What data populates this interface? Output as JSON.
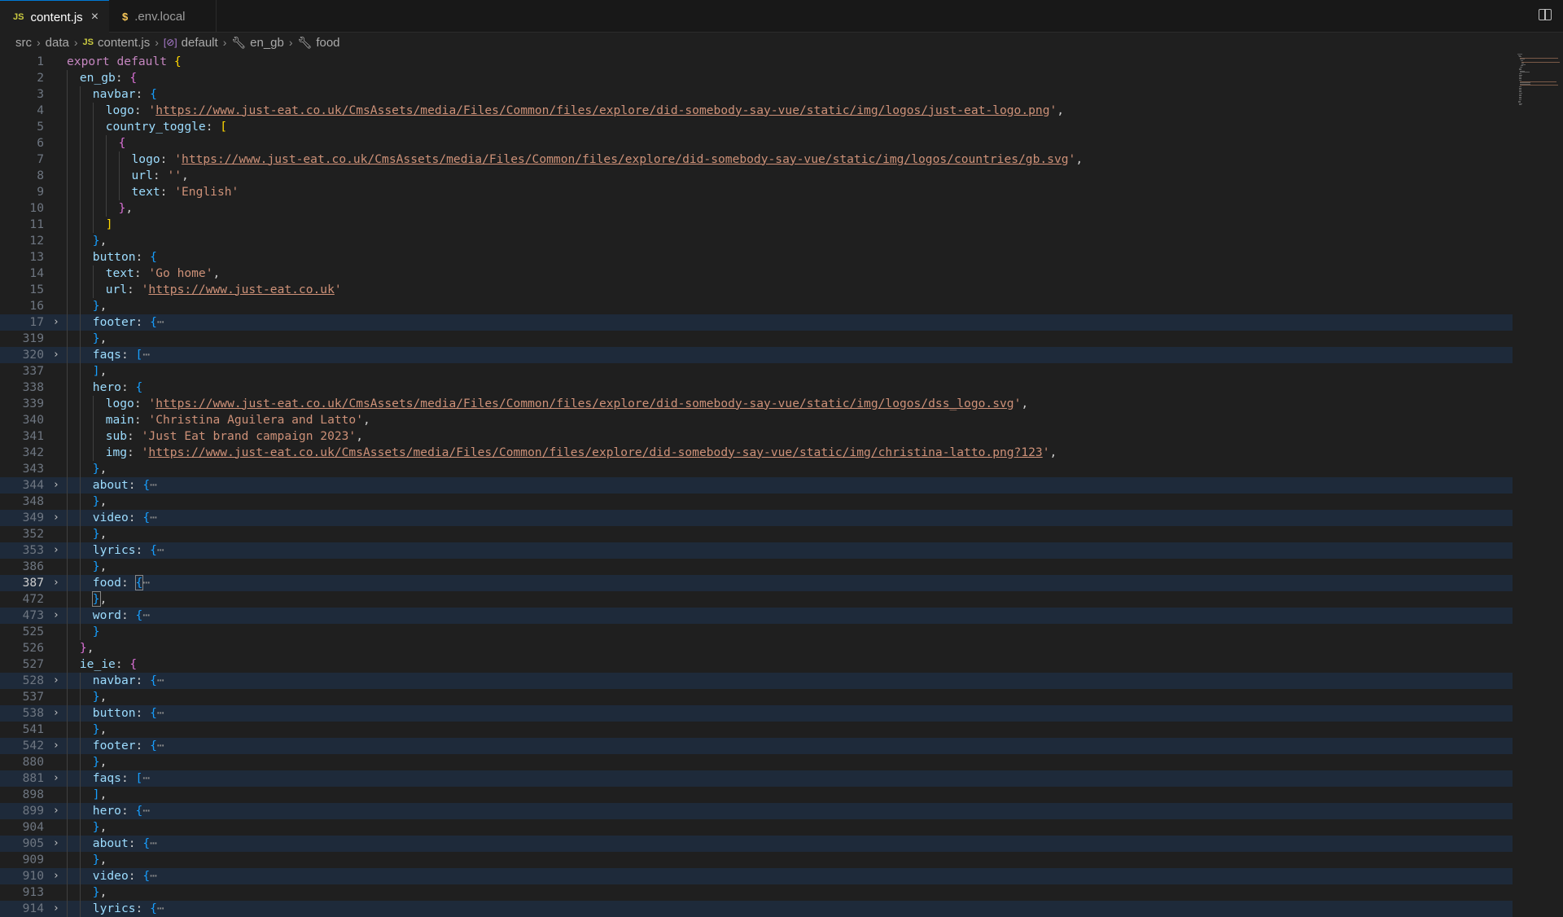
{
  "tabs": [
    {
      "label": "content.js",
      "icon": "JS",
      "close": "×"
    },
    {
      "label": ".env.local",
      "icon": "$"
    }
  ],
  "breadcrumbs": [
    {
      "label": "src",
      "icon": ""
    },
    {
      "label": "data",
      "icon": ""
    },
    {
      "label": "content.js",
      "icon": "JS"
    },
    {
      "label": "default",
      "icon": "[⊘]"
    },
    {
      "label": "en_gb",
      "icon": "wrench"
    },
    {
      "label": "food",
      "icon": "wrench"
    }
  ],
  "colors": {
    "string": "#ce9178",
    "property": "#9cdcfe",
    "keyword": "#c586c0",
    "folded_bg": "#1e2a3a"
  },
  "lines": [
    {
      "n": "1",
      "indent": 0,
      "fold": false,
      "toks": [
        [
          "kw",
          "export "
        ],
        [
          "kw",
          "default "
        ],
        [
          "p1",
          "{"
        ]
      ]
    },
    {
      "n": "2",
      "indent": 1,
      "fold": false,
      "toks": [
        [
          "prop",
          "en_gb"
        ],
        [
          "pun",
          ": "
        ],
        [
          "p2",
          "{"
        ]
      ]
    },
    {
      "n": "3",
      "indent": 2,
      "fold": false,
      "toks": [
        [
          "prop",
          "navbar"
        ],
        [
          "pun",
          ": "
        ],
        [
          "p3",
          "{"
        ]
      ]
    },
    {
      "n": "4",
      "indent": 3,
      "fold": false,
      "toks": [
        [
          "prop",
          "logo"
        ],
        [
          "pun",
          ": "
        ],
        [
          "str",
          "'"
        ],
        [
          "url",
          "https://www.just-eat.co.uk/CmsAssets/media/Files/Common/files/explore/did-somebody-say-vue/static/img/logos/just-eat-logo.png"
        ],
        [
          "str",
          "'"
        ],
        [
          "pun",
          ","
        ]
      ]
    },
    {
      "n": "5",
      "indent": 3,
      "fold": false,
      "toks": [
        [
          "prop",
          "country_toggle"
        ],
        [
          "pun",
          ": "
        ],
        [
          "p1",
          "["
        ]
      ]
    },
    {
      "n": "6",
      "indent": 4,
      "fold": false,
      "toks": [
        [
          "p2",
          "{"
        ]
      ]
    },
    {
      "n": "7",
      "indent": 5,
      "fold": false,
      "toks": [
        [
          "prop",
          "logo"
        ],
        [
          "pun",
          ": "
        ],
        [
          "str",
          "'"
        ],
        [
          "url",
          "https://www.just-eat.co.uk/CmsAssets/media/Files/Common/files/explore/did-somebody-say-vue/static/img/logos/countries/gb.svg"
        ],
        [
          "str",
          "'"
        ],
        [
          "pun",
          ","
        ]
      ]
    },
    {
      "n": "8",
      "indent": 5,
      "fold": false,
      "toks": [
        [
          "prop",
          "url"
        ],
        [
          "pun",
          ": "
        ],
        [
          "str",
          "''"
        ],
        [
          "pun",
          ","
        ]
      ]
    },
    {
      "n": "9",
      "indent": 5,
      "fold": false,
      "toks": [
        [
          "prop",
          "text"
        ],
        [
          "pun",
          ": "
        ],
        [
          "str",
          "'English'"
        ]
      ]
    },
    {
      "n": "10",
      "indent": 4,
      "fold": false,
      "toks": [
        [
          "p2",
          "}"
        ],
        [
          "pun",
          ","
        ]
      ]
    },
    {
      "n": "11",
      "indent": 3,
      "fold": false,
      "toks": [
        [
          "p1",
          "]"
        ]
      ]
    },
    {
      "n": "12",
      "indent": 2,
      "fold": false,
      "toks": [
        [
          "p3",
          "}"
        ],
        [
          "pun",
          ","
        ]
      ]
    },
    {
      "n": "13",
      "indent": 2,
      "fold": false,
      "toks": [
        [
          "prop",
          "button"
        ],
        [
          "pun",
          ": "
        ],
        [
          "p3",
          "{"
        ]
      ]
    },
    {
      "n": "14",
      "indent": 3,
      "fold": false,
      "toks": [
        [
          "prop",
          "text"
        ],
        [
          "pun",
          ": "
        ],
        [
          "str",
          "'Go home'"
        ],
        [
          "pun",
          ","
        ]
      ]
    },
    {
      "n": "15",
      "indent": 3,
      "fold": false,
      "toks": [
        [
          "prop",
          "url"
        ],
        [
          "pun",
          ": "
        ],
        [
          "str",
          "'"
        ],
        [
          "url",
          "https://www.just-eat.co.uk"
        ],
        [
          "str",
          "'"
        ]
      ]
    },
    {
      "n": "16",
      "indent": 2,
      "fold": false,
      "toks": [
        [
          "p3",
          "}"
        ],
        [
          "pun",
          ","
        ]
      ]
    },
    {
      "n": "17",
      "indent": 2,
      "fold": true,
      "toks": [
        [
          "prop",
          "footer"
        ],
        [
          "pun",
          ": "
        ],
        [
          "p3",
          "{"
        ],
        [
          "ell",
          "⋯"
        ]
      ]
    },
    {
      "n": "319",
      "indent": 2,
      "fold": false,
      "toks": [
        [
          "p3",
          "}"
        ],
        [
          "pun",
          ","
        ]
      ]
    },
    {
      "n": "320",
      "indent": 2,
      "fold": true,
      "toks": [
        [
          "prop",
          "faqs"
        ],
        [
          "pun",
          ": "
        ],
        [
          "p3",
          "["
        ],
        [
          "ell",
          "⋯"
        ]
      ]
    },
    {
      "n": "337",
      "indent": 2,
      "fold": false,
      "toks": [
        [
          "p3",
          "]"
        ],
        [
          "pun",
          ","
        ]
      ]
    },
    {
      "n": "338",
      "indent": 2,
      "fold": false,
      "toks": [
        [
          "prop",
          "hero"
        ],
        [
          "pun",
          ": "
        ],
        [
          "p3",
          "{"
        ]
      ]
    },
    {
      "n": "339",
      "indent": 3,
      "fold": false,
      "toks": [
        [
          "prop",
          "logo"
        ],
        [
          "pun",
          ": "
        ],
        [
          "str",
          "'"
        ],
        [
          "url",
          "https://www.just-eat.co.uk/CmsAssets/media/Files/Common/files/explore/did-somebody-say-vue/static/img/logos/dss_logo.svg"
        ],
        [
          "str",
          "'"
        ],
        [
          "pun",
          ","
        ]
      ]
    },
    {
      "n": "340",
      "indent": 3,
      "fold": false,
      "toks": [
        [
          "prop",
          "main"
        ],
        [
          "pun",
          ": "
        ],
        [
          "str",
          "'Christina Aguilera and Latto'"
        ],
        [
          "pun",
          ","
        ]
      ]
    },
    {
      "n": "341",
      "indent": 3,
      "fold": false,
      "toks": [
        [
          "prop",
          "sub"
        ],
        [
          "pun",
          ": "
        ],
        [
          "str",
          "'Just Eat brand campaign 2023'"
        ],
        [
          "pun",
          ","
        ]
      ]
    },
    {
      "n": "342",
      "indent": 3,
      "fold": false,
      "toks": [
        [
          "prop",
          "img"
        ],
        [
          "pun",
          ": "
        ],
        [
          "str",
          "'"
        ],
        [
          "url",
          "https://www.just-eat.co.uk/CmsAssets/media/Files/Common/files/explore/did-somebody-say-vue/static/img/christina-latto.png?123"
        ],
        [
          "str",
          "'"
        ],
        [
          "pun",
          ","
        ]
      ]
    },
    {
      "n": "343",
      "indent": 2,
      "fold": false,
      "toks": [
        [
          "p3",
          "}"
        ],
        [
          "pun",
          ","
        ]
      ]
    },
    {
      "n": "344",
      "indent": 2,
      "fold": true,
      "toks": [
        [
          "prop",
          "about"
        ],
        [
          "pun",
          ": "
        ],
        [
          "p3",
          "{"
        ],
        [
          "ell",
          "⋯"
        ]
      ]
    },
    {
      "n": "348",
      "indent": 2,
      "fold": false,
      "toks": [
        [
          "p3",
          "}"
        ],
        [
          "pun",
          ","
        ]
      ]
    },
    {
      "n": "349",
      "indent": 2,
      "fold": true,
      "toks": [
        [
          "prop",
          "video"
        ],
        [
          "pun",
          ": "
        ],
        [
          "p3",
          "{"
        ],
        [
          "ell",
          "⋯"
        ]
      ]
    },
    {
      "n": "352",
      "indent": 2,
      "fold": false,
      "toks": [
        [
          "p3",
          "}"
        ],
        [
          "pun",
          ","
        ]
      ]
    },
    {
      "n": "353",
      "indent": 2,
      "fold": true,
      "toks": [
        [
          "prop",
          "lyrics"
        ],
        [
          "pun",
          ": "
        ],
        [
          "p3",
          "{"
        ],
        [
          "ell",
          "⋯"
        ]
      ]
    },
    {
      "n": "386",
      "indent": 2,
      "fold": false,
      "toks": [
        [
          "p3",
          "}"
        ],
        [
          "pun",
          ","
        ]
      ]
    },
    {
      "n": "387",
      "indent": 2,
      "fold": true,
      "current": true,
      "toks": [
        [
          "prop",
          "food"
        ],
        [
          "pun",
          ": "
        ],
        [
          "p3 bmatch",
          "{"
        ],
        [
          "ell",
          "⋯"
        ]
      ]
    },
    {
      "n": "472",
      "indent": 2,
      "fold": false,
      "toks": [
        [
          "p3 bmatch",
          "}"
        ],
        [
          "pun",
          ","
        ]
      ]
    },
    {
      "n": "473",
      "indent": 2,
      "fold": true,
      "toks": [
        [
          "prop",
          "word"
        ],
        [
          "pun",
          ": "
        ],
        [
          "p3",
          "{"
        ],
        [
          "ell",
          "⋯"
        ]
      ]
    },
    {
      "n": "525",
      "indent": 2,
      "fold": false,
      "toks": [
        [
          "p3",
          "}"
        ]
      ]
    },
    {
      "n": "526",
      "indent": 1,
      "fold": false,
      "toks": [
        [
          "p2",
          "}"
        ],
        [
          "pun",
          ","
        ]
      ]
    },
    {
      "n": "527",
      "indent": 1,
      "fold": false,
      "toks": [
        [
          "prop",
          "ie_ie"
        ],
        [
          "pun",
          ": "
        ],
        [
          "p2",
          "{"
        ]
      ]
    },
    {
      "n": "528",
      "indent": 2,
      "fold": true,
      "toks": [
        [
          "prop",
          "navbar"
        ],
        [
          "pun",
          ": "
        ],
        [
          "p3",
          "{"
        ],
        [
          "ell",
          "⋯"
        ]
      ]
    },
    {
      "n": "537",
      "indent": 2,
      "fold": false,
      "toks": [
        [
          "p3",
          "}"
        ],
        [
          "pun",
          ","
        ]
      ]
    },
    {
      "n": "538",
      "indent": 2,
      "fold": true,
      "toks": [
        [
          "prop",
          "button"
        ],
        [
          "pun",
          ": "
        ],
        [
          "p3",
          "{"
        ],
        [
          "ell",
          "⋯"
        ]
      ]
    },
    {
      "n": "541",
      "indent": 2,
      "fold": false,
      "toks": [
        [
          "p3",
          "}"
        ],
        [
          "pun",
          ","
        ]
      ]
    },
    {
      "n": "542",
      "indent": 2,
      "fold": true,
      "toks": [
        [
          "prop",
          "footer"
        ],
        [
          "pun",
          ": "
        ],
        [
          "p3",
          "{"
        ],
        [
          "ell",
          "⋯"
        ]
      ]
    },
    {
      "n": "880",
      "indent": 2,
      "fold": false,
      "toks": [
        [
          "p3",
          "}"
        ],
        [
          "pun",
          ","
        ]
      ]
    },
    {
      "n": "881",
      "indent": 2,
      "fold": true,
      "toks": [
        [
          "prop",
          "faqs"
        ],
        [
          "pun",
          ": "
        ],
        [
          "p3",
          "["
        ],
        [
          "ell",
          "⋯"
        ]
      ]
    },
    {
      "n": "898",
      "indent": 2,
      "fold": false,
      "toks": [
        [
          "p3",
          "]"
        ],
        [
          "pun",
          ","
        ]
      ]
    },
    {
      "n": "899",
      "indent": 2,
      "fold": true,
      "toks": [
        [
          "prop",
          "hero"
        ],
        [
          "pun",
          ": "
        ],
        [
          "p3",
          "{"
        ],
        [
          "ell",
          "⋯"
        ]
      ]
    },
    {
      "n": "904",
      "indent": 2,
      "fold": false,
      "toks": [
        [
          "p3",
          "}"
        ],
        [
          "pun",
          ","
        ]
      ]
    },
    {
      "n": "905",
      "indent": 2,
      "fold": true,
      "toks": [
        [
          "prop",
          "about"
        ],
        [
          "pun",
          ": "
        ],
        [
          "p3",
          "{"
        ],
        [
          "ell",
          "⋯"
        ]
      ]
    },
    {
      "n": "909",
      "indent": 2,
      "fold": false,
      "toks": [
        [
          "p3",
          "}"
        ],
        [
          "pun",
          ","
        ]
      ]
    },
    {
      "n": "910",
      "indent": 2,
      "fold": true,
      "toks": [
        [
          "prop",
          "video"
        ],
        [
          "pun",
          ": "
        ],
        [
          "p3",
          "{"
        ],
        [
          "ell",
          "⋯"
        ]
      ]
    },
    {
      "n": "913",
      "indent": 2,
      "fold": false,
      "toks": [
        [
          "p3",
          "}"
        ],
        [
          "pun",
          ","
        ]
      ]
    },
    {
      "n": "914",
      "indent": 2,
      "fold": true,
      "toks": [
        [
          "prop",
          "lyrics"
        ],
        [
          "pun",
          ": "
        ],
        [
          "p3",
          "{"
        ],
        [
          "ell",
          "⋯"
        ]
      ]
    }
  ]
}
